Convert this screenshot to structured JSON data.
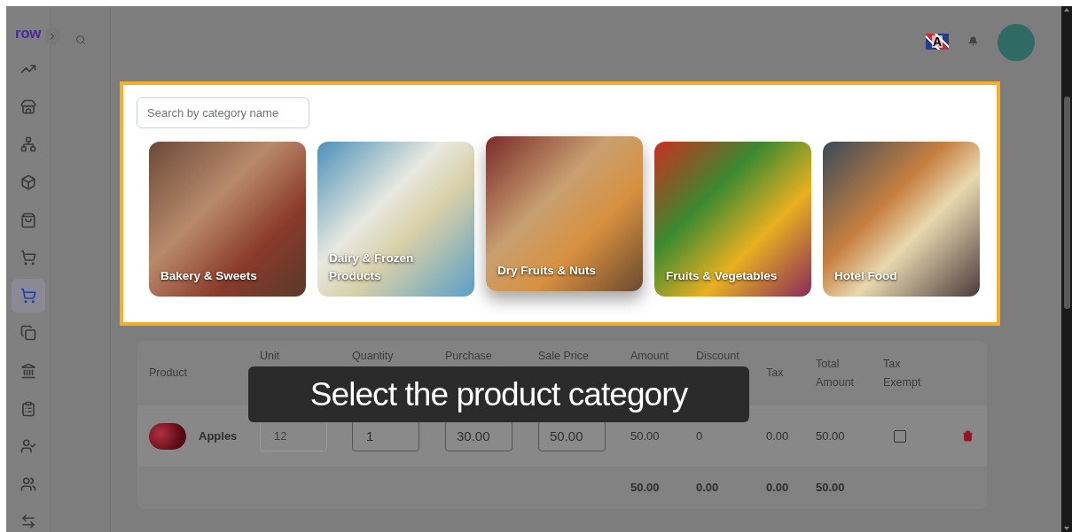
{
  "sidebar": {
    "logo": "row",
    "items": [
      {
        "selected": false
      },
      {
        "selected": false
      },
      {
        "selected": false
      },
      {
        "selected": false
      },
      {
        "selected": false
      },
      {
        "selected": false
      },
      {
        "selected": true
      },
      {
        "selected": false
      },
      {
        "selected": false
      },
      {
        "selected": false
      },
      {
        "selected": false
      },
      {
        "selected": false
      },
      {
        "selected": false
      }
    ]
  },
  "header": {
    "language_label": "A"
  },
  "category_picker": {
    "search": {
      "placeholder": "Search by category name"
    },
    "categories": [
      {
        "label": "Bakery & Sweets",
        "selected": false
      },
      {
        "label": "Dairy & Frozen Products",
        "selected": false
      },
      {
        "label": "Dry Fruits & Nuts",
        "selected": true
      },
      {
        "label": "Fruits & Vegetables",
        "selected": false
      },
      {
        "label": "Hotel Food",
        "selected": false
      }
    ]
  },
  "table": {
    "columns": [
      "Product",
      "Unit",
      "Quantity",
      "Purchase",
      "Sale Price",
      "Amount",
      "Discount",
      "Tax",
      "Total Amount",
      "Tax Exempt"
    ],
    "rows": [
      {
        "product": "Apples",
        "unit": "12",
        "quantity": "1",
        "purchase_cost": "30.00",
        "sale_price": "50.00",
        "amount": "50.00",
        "discount": "0",
        "tax": "0.00",
        "total_amount": "50.00",
        "tax_exempt": false
      }
    ],
    "totals": {
      "amount": "50.00",
      "discount": "0.00",
      "tax": "0.00",
      "total_amount": "50.00"
    }
  },
  "tooltip": "Select the product category"
}
